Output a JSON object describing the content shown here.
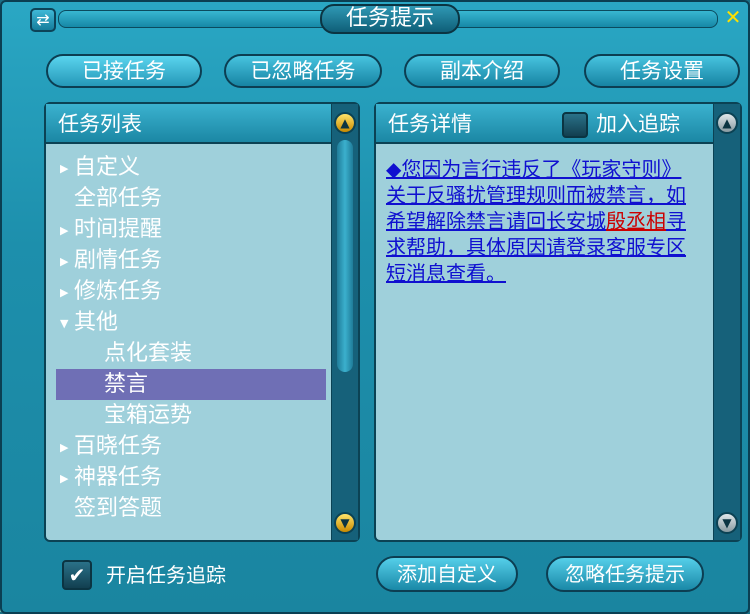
{
  "window": {
    "title": "任务提示",
    "swap_icon": "⇄",
    "close_icon": "✕"
  },
  "tabs": [
    {
      "label": "已接任务",
      "active": true
    },
    {
      "label": "已忽略任务",
      "active": false
    },
    {
      "label": "副本介绍",
      "active": false
    },
    {
      "label": "任务设置",
      "active": false
    }
  ],
  "task_list": {
    "header": "任务列表",
    "items": [
      {
        "label": "自定义",
        "arrow": "▶",
        "indent": 0,
        "selected": false
      },
      {
        "label": "全部任务",
        "arrow": "",
        "indent": 0,
        "selected": false
      },
      {
        "label": "时间提醒",
        "arrow": "▶",
        "indent": 0,
        "selected": false
      },
      {
        "label": "剧情任务",
        "arrow": "▶",
        "indent": 0,
        "selected": false
      },
      {
        "label": "修炼任务",
        "arrow": "▶",
        "indent": 0,
        "selected": false
      },
      {
        "label": "其他",
        "arrow": "▼",
        "indent": 0,
        "selected": false
      },
      {
        "label": "点化套装",
        "arrow": "",
        "indent": 1,
        "selected": false
      },
      {
        "label": "禁言",
        "arrow": "",
        "indent": 1,
        "selected": true
      },
      {
        "label": "宝箱运势",
        "arrow": "",
        "indent": 1,
        "selected": false
      },
      {
        "label": "百晓任务",
        "arrow": "▶",
        "indent": 0,
        "selected": false
      },
      {
        "label": "神器任务",
        "arrow": "▶",
        "indent": 0,
        "selected": false
      },
      {
        "label": "签到答题",
        "arrow": "",
        "indent": 0,
        "selected": false
      }
    ]
  },
  "task_detail": {
    "header": "任务详情",
    "track_label": "加入追踪",
    "text_before": "◆您因为言行违反了《玩家守则》关于反骚扰管理规则而被禁言，如希望解除禁言请回长安城",
    "npc": "殷丞相",
    "text_after": "寻求帮助，具体原因请登录客服专区短消息查看。"
  },
  "footer": {
    "enable_tracking_label": "开启任务追踪",
    "enable_tracking_checked": true,
    "add_custom_label": "添加自定义",
    "ignore_label": "忽略任务提示"
  },
  "icons": {
    "scroll_up": "▲",
    "scroll_down": "▼",
    "check": "✔"
  }
}
